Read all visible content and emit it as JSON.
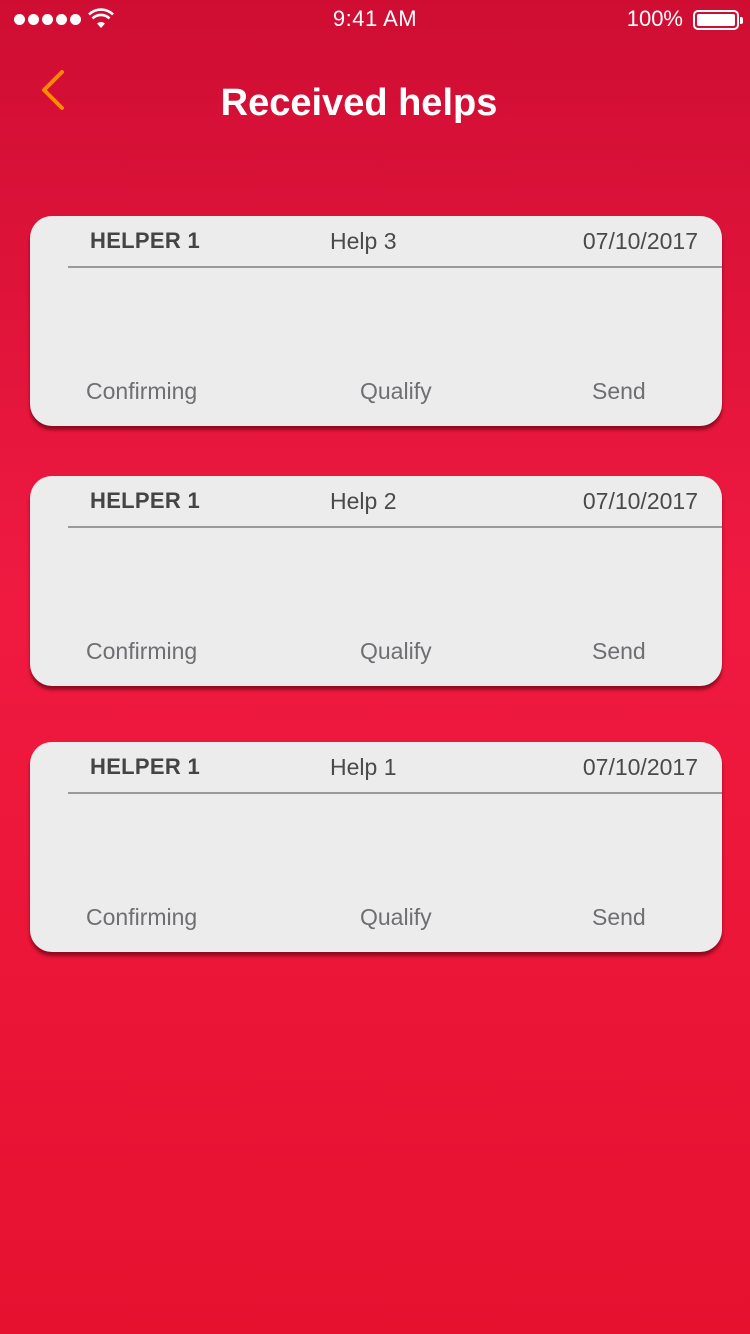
{
  "status_bar": {
    "time": "9:41 AM",
    "battery": "100%"
  },
  "header": {
    "title": "Received helps",
    "back_icon": "chevron-left-icon",
    "back_color": "#ff8a00"
  },
  "cards": [
    {
      "helper": "HELPER 1",
      "help": "Help 3",
      "date": "07/10/2017",
      "actions": [
        "Confirming",
        "Qualify",
        "Send"
      ]
    },
    {
      "helper": "HELPER 1",
      "help": "Help 2",
      "date": "07/10/2017",
      "actions": [
        "Confirming",
        "Qualify",
        "Send"
      ]
    },
    {
      "helper": "HELPER 1",
      "help": "Help 1",
      "date": "07/10/2017",
      "actions": [
        "Confirming",
        "Qualify",
        "Send"
      ]
    }
  ],
  "colors": {
    "background_top": "#cf0d33",
    "background_bottom": "#e6112f",
    "card": "#ececec"
  }
}
